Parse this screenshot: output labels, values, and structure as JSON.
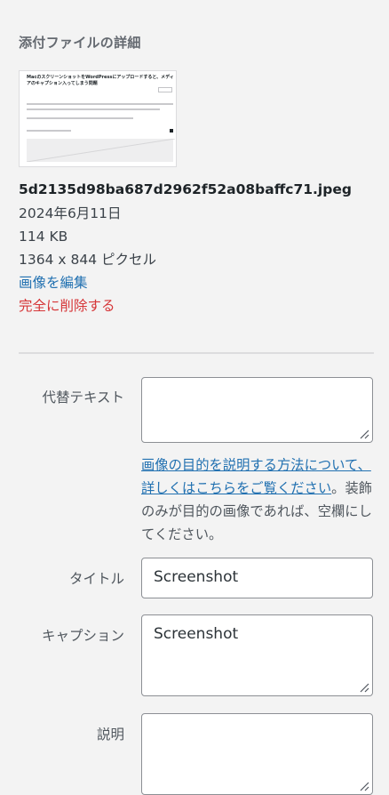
{
  "panel": {
    "heading": "添付ファイルの詳細"
  },
  "thumbnail": {
    "title": "MacのスクリーンショットをWordPressにアップロードすると、メディアのキャプション入ってしまう問題"
  },
  "details": {
    "filename": "5d2135d98ba687d2962f52a08baffc71.jpeg",
    "date": "2024年6月11日",
    "filesize": "114 KB",
    "dimensions": "1364 x 844 ピクセル",
    "edit_link": "画像を編集",
    "delete_link": "完全に削除する"
  },
  "fields": {
    "alt": {
      "label": "代替テキスト",
      "value": ""
    },
    "alt_help": {
      "link": "画像の目的を説明する方法について、詳しくはこちらをご覧ください",
      "text": "。装飾のみが目的の画像であれば、空欄にしてください。"
    },
    "title": {
      "label": "タイトル",
      "value": "Screenshot"
    },
    "caption": {
      "label": "キャプション",
      "value": "Screenshot"
    },
    "description": {
      "label": "説明",
      "value": ""
    }
  },
  "colors": {
    "link": "#2271b1",
    "danger": "#d63638",
    "background": "#f3f3f3"
  }
}
